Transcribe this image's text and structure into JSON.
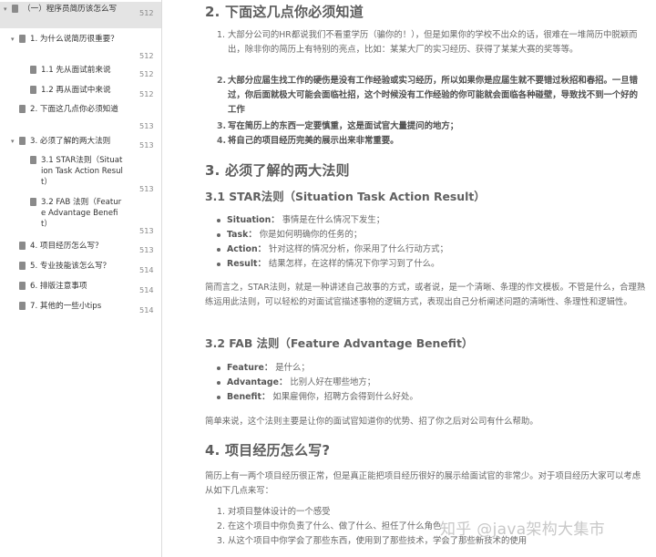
{
  "toc": {
    "items": [
      {
        "label": "（一）程序员简历该怎么写",
        "page": "512",
        "arrow": "▾",
        "level": 0,
        "active": true
      },
      {
        "label": "1. 为什么说简历很重要？",
        "page": "512",
        "arrow": "▾",
        "level": 1
      },
      {
        "label": "1.1 先从面试前来说",
        "page": "512",
        "arrow": "",
        "level": 2
      },
      {
        "label": "1.2 再从面试中来说",
        "page": "512",
        "arrow": "",
        "level": 2
      },
      {
        "label": "2. 下面这几点你必须知道",
        "page": "513",
        "arrow": "",
        "level": 1
      },
      {
        "label": "3. 必须了解的两大法则",
        "page": "513",
        "arrow": "▾",
        "level": 1
      },
      {
        "label": "3.1 STAR法则（Situation Task Action Result）",
        "page": "513",
        "arrow": "",
        "level": 2
      },
      {
        "label": "3.2 FAB 法则（Feature Advantage Benefit）",
        "page": "513",
        "arrow": "",
        "level": 2
      },
      {
        "label": "4. 项目经历怎么写？",
        "page": "513",
        "arrow": "",
        "level": 1
      },
      {
        "label": "5. 专业技能该怎么写？",
        "page": "514",
        "arrow": "",
        "level": 1
      },
      {
        "label": "6. 排版注意事项",
        "page": "514",
        "arrow": "",
        "level": 1
      },
      {
        "label": "7. 其他的一些小tips",
        "page": "514",
        "arrow": "",
        "level": 1
      }
    ]
  },
  "doc": {
    "h2_know": "2. 下面这几点你必须知道",
    "know_items": [
      {
        "num": "1.",
        "text": "大部分公司的HR都说我们不看重学历（骗你的！），但是如果你的学校不出众的话，很难在一堆简历中脱颖而出，除非你的简历上有特别的亮点，比如：某某大厂的实习经历、获得了某某大赛的奖等等。",
        "bold": false
      },
      {
        "num": "2.",
        "text": "大部分应届生找工作的硬伤是没有工作经验或实习经历，所以如果你是应届生就不要错过秋招和春招。一旦错过，你后面就极大可能会面临社招，这个时候没有工作经验的你可能就会面临各种碰壁，导致找不到一个好的工作",
        "bold": true
      },
      {
        "num": "3.",
        "text": "写在简历上的东西一定要慎重，这是面试官大量提问的地方；",
        "bold": true
      },
      {
        "num": "4.",
        "text": "将自己的项目经历完美的展示出来非常重要。",
        "bold": true
      }
    ],
    "h2_rules": "3. 必须了解的两大法则",
    "h3_star": "3.1 STAR法则（Situation Task Action Result）",
    "star_items": [
      {
        "term": "Situation：",
        "text": "事情是在什么情况下发生；"
      },
      {
        "term": "Task：",
        "text": "你是如何明确你的任务的；"
      },
      {
        "term": "Action：",
        "text": "针对这样的情况分析，你采用了什么行动方式；"
      },
      {
        "term": "Result：",
        "text": "结果怎样，在这样的情况下你学习到了什么。"
      }
    ],
    "star_summary": "简而言之，STAR法则，就是一种讲述自己故事的方式，或者说，是一个清晰、条理的作文模板。不管是什么，合理熟练运用此法则，可以轻松的对面试官描述事物的逻辑方式，表现出自己分析阐述问题的清晰性、条理性和逻辑性。",
    "h3_fab": "3.2 FAB 法则（Feature Advantage Benefit）",
    "fab_items": [
      {
        "term": "Feature：",
        "text": "是什么；"
      },
      {
        "term": "Advantage：",
        "text": "比别人好在哪些地方；"
      },
      {
        "term": "Benefit：",
        "text": "如果雇佣你，招聘方会得到什么好处。"
      }
    ],
    "fab_summary": "简单来说，这个法则主要是让你的面试官知道你的优势、招了你之后对公司有什么帮助。",
    "h2_project": "4. 项目经历怎么写?",
    "project_intro": "简历上有一两个项目经历很正常，但是真正能把项目经历很好的展示给面试官的非常少。对于项目经历大家可以考虑从如下几点来写：",
    "project_items": [
      {
        "num": "1.",
        "text": "对项目整体设计的一个感受"
      },
      {
        "num": "2.",
        "text": "在这个项目中你负责了什么、做了什么、担任了什么角色"
      },
      {
        "num": "3.",
        "text": "从这个项目中你学会了那些东西，使用到了那些技术，学会了那些新技术的使用"
      }
    ]
  },
  "watermark": "知乎 @java架构大集市"
}
